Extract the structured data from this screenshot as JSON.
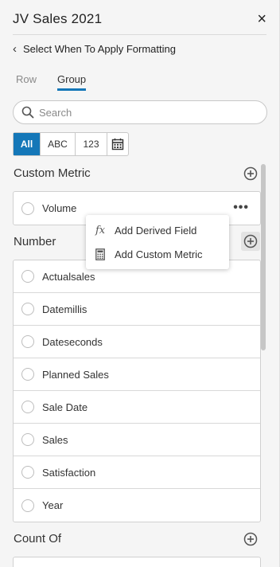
{
  "header": {
    "title": "JV Sales 2021",
    "close_label": "×"
  },
  "back": {
    "chevron": "‹",
    "label": "Select When To Apply Formatting"
  },
  "tabs": [
    {
      "label": "Row",
      "active": false
    },
    {
      "label": "Group",
      "active": true
    }
  ],
  "search": {
    "placeholder": "Search",
    "value": ""
  },
  "filters": {
    "all": "All",
    "abc": "ABC",
    "num": "123",
    "calendar_icon": "calendar-icon"
  },
  "sections": {
    "custom_metric": {
      "title": "Custom Metric",
      "items": [
        "Volume"
      ]
    },
    "number": {
      "title": "Number",
      "items": [
        "Actualsales",
        "Datemillis",
        "Dateseconds",
        "Planned Sales",
        "Sale Date",
        "Sales",
        "Satisfaction",
        "Year"
      ]
    },
    "count_of": {
      "title": "Count Of"
    }
  },
  "more_label": "•••",
  "menu": {
    "items": [
      {
        "icon": "fx",
        "label": "Add Derived Field"
      },
      {
        "icon": "calculator-icon",
        "label": "Add Custom Metric"
      }
    ]
  },
  "colors": {
    "accent": "#1477b8",
    "background": "#f5f5f5"
  }
}
